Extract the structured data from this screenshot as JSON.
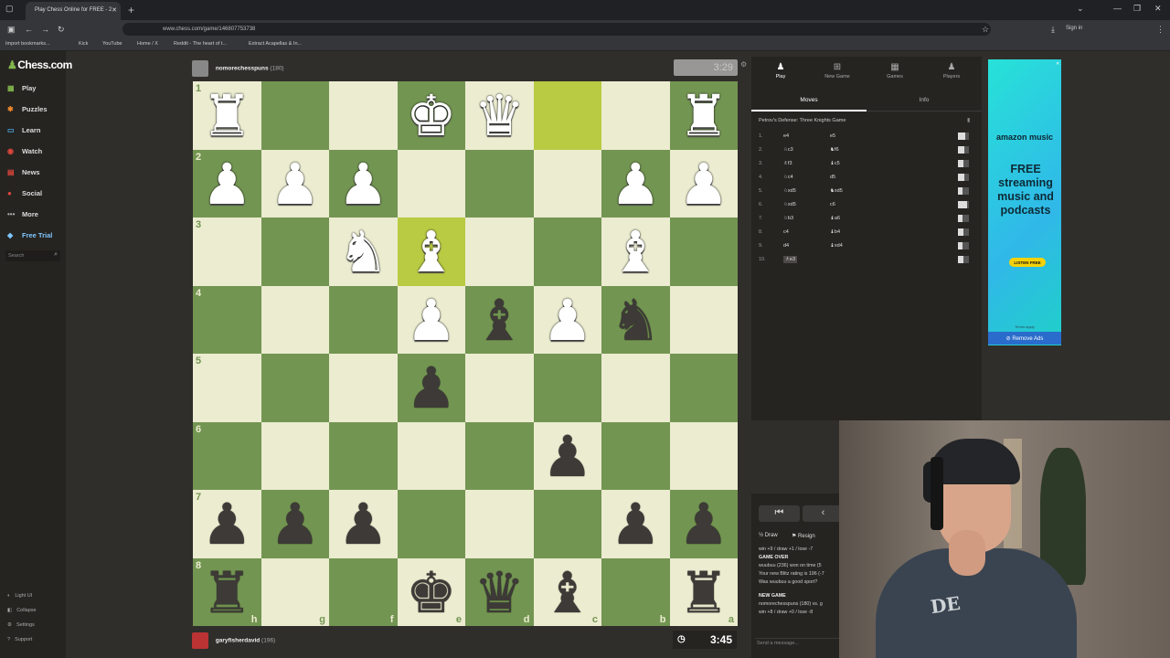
{
  "browser": {
    "tab_title": "Play Chess Online for FREE - 2",
    "url": "www.chess.com/game/146807753738",
    "signin": "Sign in",
    "bookmarks": [
      "Import bookmarks...",
      "Kick",
      "YouTube",
      "Home / X",
      "Reddit - The heart of t...",
      "Extract Acapellas & In..."
    ]
  },
  "sidebar": {
    "logo": "Chess.com",
    "items": [
      {
        "label": "Play",
        "icon": "play-board-icon"
      },
      {
        "label": "Puzzles",
        "icon": "puzzle-icon"
      },
      {
        "label": "Learn",
        "icon": "learn-icon"
      },
      {
        "label": "Watch",
        "icon": "watch-icon"
      },
      {
        "label": "News",
        "icon": "news-icon"
      },
      {
        "label": "Social",
        "icon": "social-icon"
      },
      {
        "label": "More",
        "icon": "more-icon"
      },
      {
        "label": "Free Trial",
        "icon": "diamond-icon"
      }
    ],
    "search_placeholder": "Search",
    "bottom": [
      "Light UI",
      "Collapse",
      "Settings",
      "Support"
    ]
  },
  "game": {
    "top_player": {
      "name": "nomorechesspuns",
      "rating": "(180)"
    },
    "bottom_player": {
      "name": "garyfisherdavid",
      "rating": "(196)"
    },
    "top_clock": "3:29",
    "bottom_clock": "3:45",
    "ranks": [
      "1",
      "2",
      "3",
      "4",
      "5",
      "6",
      "7",
      "8"
    ],
    "files": [
      "h",
      "g",
      "f",
      "e",
      "d",
      "c",
      "b",
      "a"
    ]
  },
  "panel": {
    "tabs": [
      {
        "label": "Play",
        "icon": "play-icon"
      },
      {
        "label": "New Game",
        "icon": "plus-icon"
      },
      {
        "label": "Games",
        "icon": "games-icon"
      },
      {
        "label": "Players",
        "icon": "players-icon"
      }
    ],
    "subtabs": [
      "Moves",
      "Info"
    ],
    "opening": "Petrov's Defense: Three Knights Game",
    "moves": [
      {
        "n": "1.",
        "w": "e4",
        "b": "e5",
        "eval": 0.7
      },
      {
        "n": "2.",
        "w": "♘c3",
        "b": "♞f6",
        "eval": 0.6
      },
      {
        "n": "3.",
        "w": "♗f3",
        "b": "♝c5",
        "eval": 0.5
      },
      {
        "n": "4.",
        "w": "♘c4",
        "b": "d5",
        "eval": 0.6
      },
      {
        "n": "5.",
        "w": "♘xd5",
        "b": "♞xd5",
        "eval": 0.4
      },
      {
        "n": "6.",
        "w": "♘xd5",
        "b": "c6",
        "eval": 0.8
      },
      {
        "n": "7.",
        "w": "♘b3",
        "b": "♝a6",
        "eval": 0.4
      },
      {
        "n": "8.",
        "w": "c4",
        "b": "♝b4",
        "eval": 0.5
      },
      {
        "n": "9.",
        "w": "d4",
        "b": "♝xd4",
        "eval": 0.4
      },
      {
        "n": "10.",
        "w": "♗e3",
        "b": "",
        "eval": 0.5
      }
    ]
  },
  "ad": {
    "brand": "amazon music",
    "text": "FREE streaming music and podcasts",
    "button": "LISTEN FREE",
    "terms": "Terms apply",
    "remove": "Remove Ads"
  },
  "chat": {
    "draw": "Draw",
    "resign": "Resign",
    "lines": [
      {
        "t": "win +9 / draw +1 / lose -7",
        "hdr": false
      },
      {
        "t": "GAME OVER",
        "hdr": true
      },
      {
        "t": "wuubuu (236) won on time (5",
        "hdr": false
      },
      {
        "t": "Your new Blitz rating is 196 (-7",
        "hdr": false
      },
      {
        "t": "Was wuubuu a good sport?",
        "hdr": false
      },
      {
        "t": "NEW GAME",
        "hdr": true
      },
      {
        "t": "nomorechesspuns (180) vs. g",
        "hdr": false
      },
      {
        "t": "win +8 / draw +0 / lose -8",
        "hdr": false
      }
    ],
    "placeholder": "Send a message..."
  }
}
